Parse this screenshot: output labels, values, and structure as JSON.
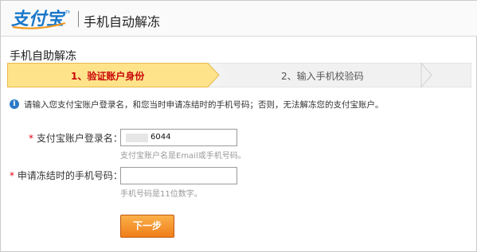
{
  "header": {
    "logo_text": "支付宝",
    "title": "手机自动解冻"
  },
  "page": {
    "title": "手机自助解冻"
  },
  "steps": [
    {
      "label": "1、验证账户身份",
      "active": true
    },
    {
      "label": "2、输入手机校验码",
      "active": false
    }
  ],
  "notice": {
    "icon": "info-icon",
    "text": "请输入您支付宝账户登录名，和您当时申请冻结时的手机号码；否则，无法解冻您的支付宝账户。"
  },
  "form": {
    "account": {
      "required_mark": "*",
      "label": "支付宝账户登录名：",
      "value": "6044",
      "hint": "支付宝账户名是Email或手机号码。"
    },
    "phone": {
      "required_mark": "*",
      "label": "申请冻结时的手机号码：",
      "value": "",
      "hint": "手机号码是11位数字。"
    },
    "next_label": "下一步"
  },
  "colors": {
    "active_step_bg": "#ffe38a",
    "active_step_text": "#c9070b",
    "required": "#e60012",
    "button": "#f29227",
    "info_icon": "#2b7ac9"
  }
}
